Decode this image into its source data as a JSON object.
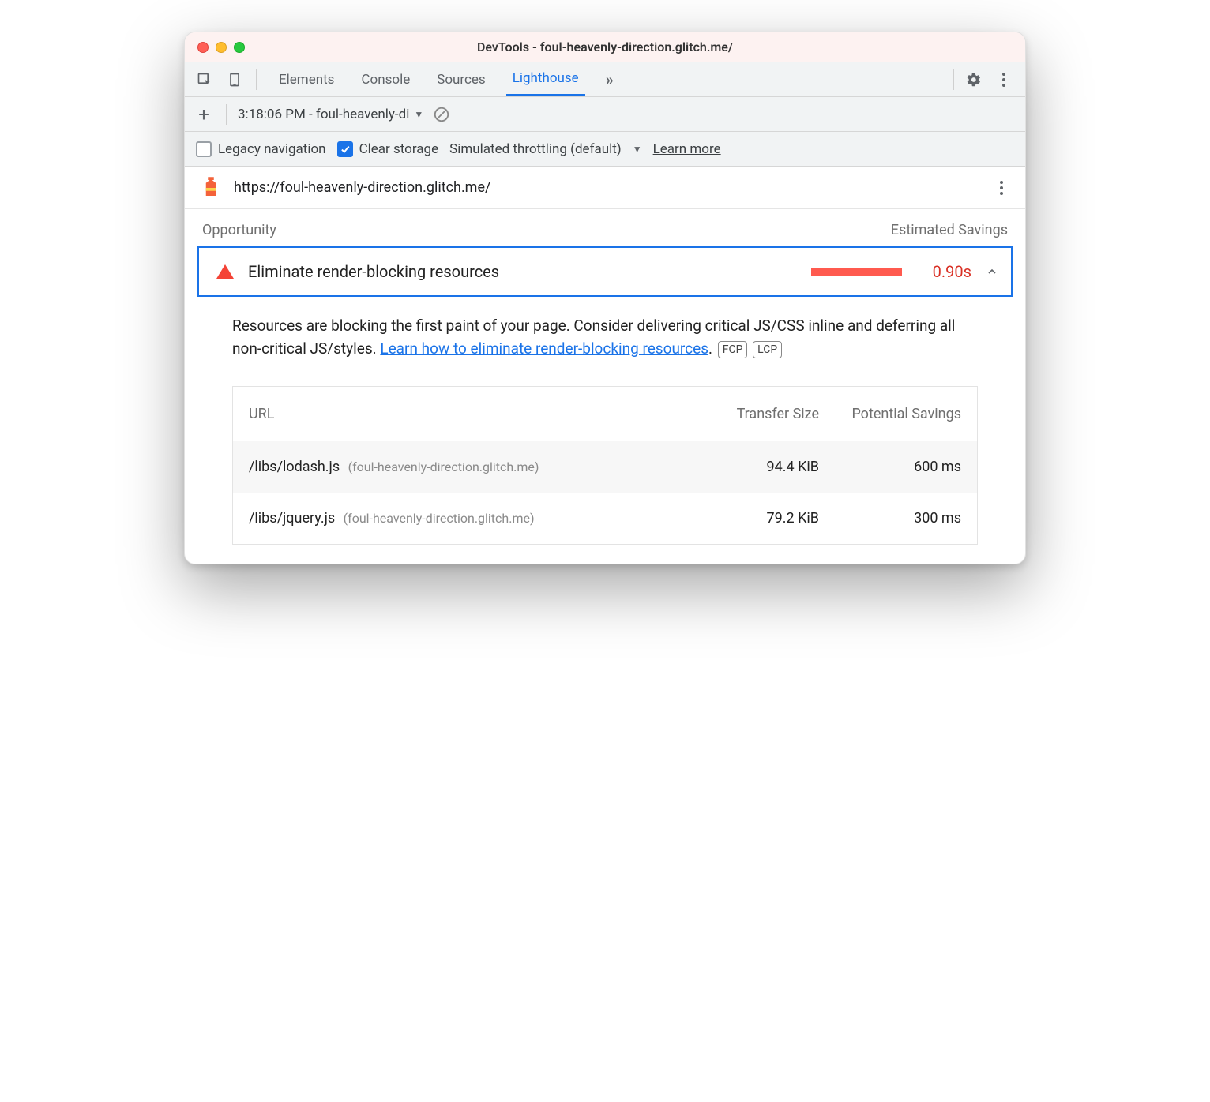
{
  "window": {
    "title": "DevTools - foul-heavenly-direction.glitch.me/"
  },
  "tabs": {
    "items": [
      "Elements",
      "Console",
      "Sources",
      "Lighthouse"
    ],
    "active": "Lighthouse",
    "overflow_glyph": "»"
  },
  "subtoolbar": {
    "plus": "+",
    "report_label": "3:18:06 PM - foul-heavenly-di"
  },
  "options": {
    "legacy_label": "Legacy navigation",
    "legacy_checked": false,
    "clear_label": "Clear storage",
    "clear_checked": true,
    "throttling_label": "Simulated throttling (default)",
    "learn_more": "Learn more"
  },
  "url_row": {
    "url": "https://foul-heavenly-direction.glitch.me/"
  },
  "section": {
    "opportunity_label": "Opportunity",
    "savings_label": "Estimated Savings"
  },
  "opportunity": {
    "title": "Eliminate render-blocking resources",
    "time": "0.90s"
  },
  "description": {
    "text_before": "Resources are blocking the first paint of your page. Consider delivering critical JS/CSS inline and deferring all non-critical JS/styles. ",
    "link_text": "Learn how to eliminate render-blocking resources",
    "text_after": ".",
    "tag1": "FCP",
    "tag2": "LCP"
  },
  "table": {
    "headers": {
      "url": "URL",
      "transfer": "Transfer Size",
      "savings": "Potential Savings"
    },
    "rows": [
      {
        "path": "/libs/lodash.js",
        "host": "(foul-heavenly-direction.glitch.me)",
        "transfer": "94.4 KiB",
        "savings": "600 ms"
      },
      {
        "path": "/libs/jquery.js",
        "host": "(foul-heavenly-direction.glitch.me)",
        "transfer": "79.2 KiB",
        "savings": "300 ms"
      }
    ]
  }
}
